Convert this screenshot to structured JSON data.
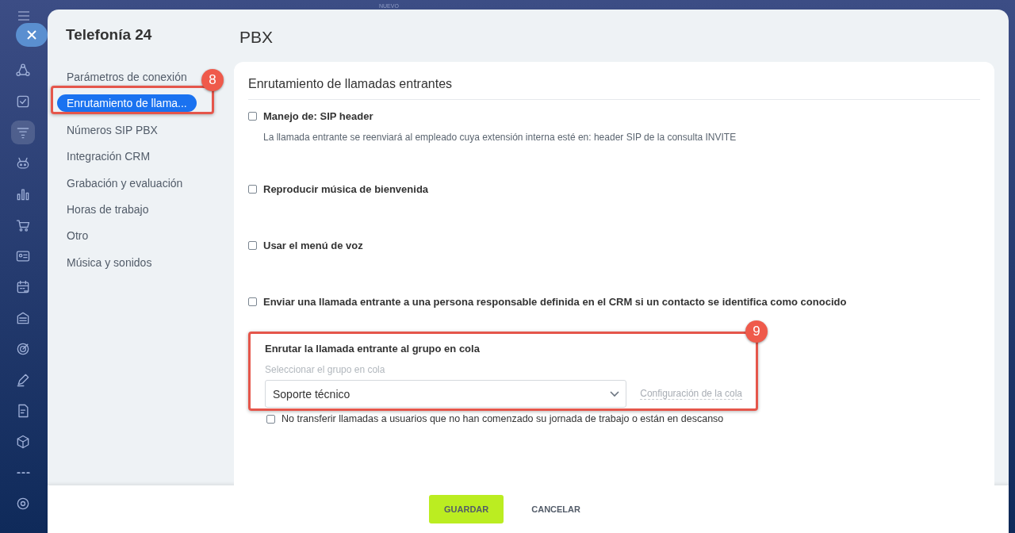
{
  "backdrop": {
    "label": "NUEVO"
  },
  "rail": [
    {
      "kind": "share",
      "selected": false
    },
    {
      "kind": "task",
      "selected": false
    },
    {
      "kind": "filter",
      "selected": true
    },
    {
      "kind": "robot",
      "selected": false
    },
    {
      "kind": "chart",
      "selected": false
    },
    {
      "kind": "cart",
      "selected": false
    },
    {
      "kind": "card",
      "selected": false
    },
    {
      "kind": "calendar",
      "selected": false
    },
    {
      "kind": "storage",
      "selected": false
    },
    {
      "kind": "target",
      "selected": false
    },
    {
      "kind": "pen",
      "selected": false
    },
    {
      "kind": "doc",
      "selected": false
    },
    {
      "kind": "cube",
      "selected": false
    },
    {
      "kind": "dots",
      "selected": false
    },
    {
      "kind": "gear",
      "selected": false
    }
  ],
  "panel": {
    "app_title": "Telefonía 24",
    "page_title": "PBX"
  },
  "nav": [
    {
      "label": "Parámetros de conexión",
      "selected": false
    },
    {
      "label": "Enrutamiento de llama...",
      "selected": true,
      "callout": "8"
    },
    {
      "label": "Números SIP PBX",
      "selected": false
    },
    {
      "label": "Integración CRM",
      "selected": false
    },
    {
      "label": "Grabación y evaluación",
      "selected": false
    },
    {
      "label": "Horas de trabajo",
      "selected": false
    },
    {
      "label": "Otro",
      "selected": false
    },
    {
      "label": "Música y sonidos",
      "selected": false
    }
  ],
  "section": {
    "title": "Enrutamiento de llamadas entrantes",
    "options": [
      {
        "label": "Manejo de: SIP header",
        "checked": false,
        "hint": "La llamada entrante se reenviará al empleado cuya extensión interna esté en: header SIP de la consulta INVITE"
      },
      {
        "label": "Reproducir música de bienvenida",
        "checked": false
      },
      {
        "label": "Usar el menú de voz",
        "checked": false
      },
      {
        "label": "Enviar una llamada entrante a una persona responsable definida en el CRM si un contacto se identifica como conocido",
        "checked": false
      }
    ],
    "queue": {
      "callout": "9",
      "title": "Enrutar la llamada entrante al grupo en cola",
      "field_label": "Seleccionar el grupo en cola",
      "value": "Soporte técnico",
      "link": "Configuración de la cola"
    },
    "extra_option": {
      "label": "No transferir llamadas a usuarios que no han comenzado su jornada de trabajo o están en descanso",
      "checked": false
    }
  },
  "footer": {
    "buttons": [
      {
        "label": "GUARDAR",
        "kind": "primary"
      },
      {
        "label": "CANCELAR",
        "kind": "plain"
      }
    ]
  }
}
